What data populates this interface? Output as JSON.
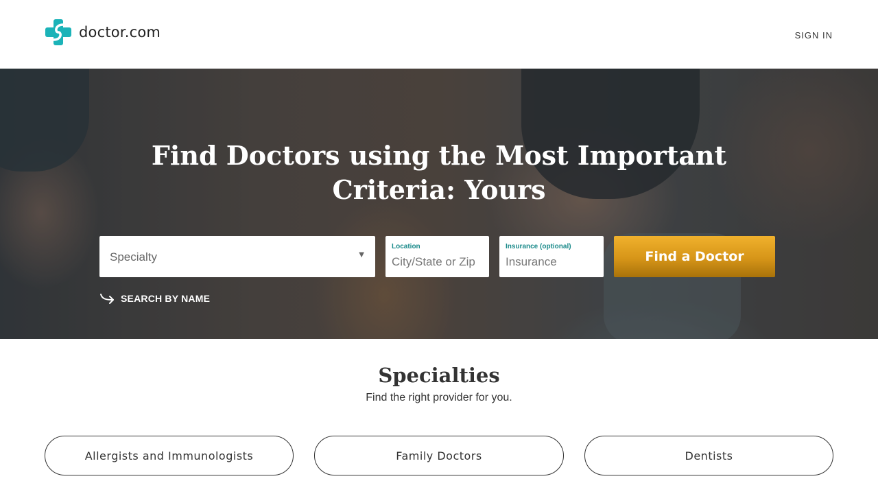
{
  "header": {
    "logo_text": "doctor.com",
    "logo_icon": "medical-cross-logo",
    "signin_label": "SIGN IN",
    "brand_color": "#1bb3b8"
  },
  "hero": {
    "title": "Find Doctors using the Most Important Criteria: Yours",
    "specialty_placeholder": "Specialty",
    "location_label": "Location",
    "location_placeholder": "City/State or Zip",
    "insurance_label": "Insurance (optional)",
    "insurance_placeholder": "Insurance",
    "find_button_label": "Find a Doctor",
    "search_by_name_label": "SEARCH BY NAME",
    "button_color": "#d69518",
    "label_color": "#1a8a8a"
  },
  "specialties": {
    "title": "Specialties",
    "subtitle": "Find the right provider for you.",
    "items": [
      {
        "label": "Allergists and Immunologists"
      },
      {
        "label": "Family Doctors"
      },
      {
        "label": "Dentists"
      }
    ]
  }
}
